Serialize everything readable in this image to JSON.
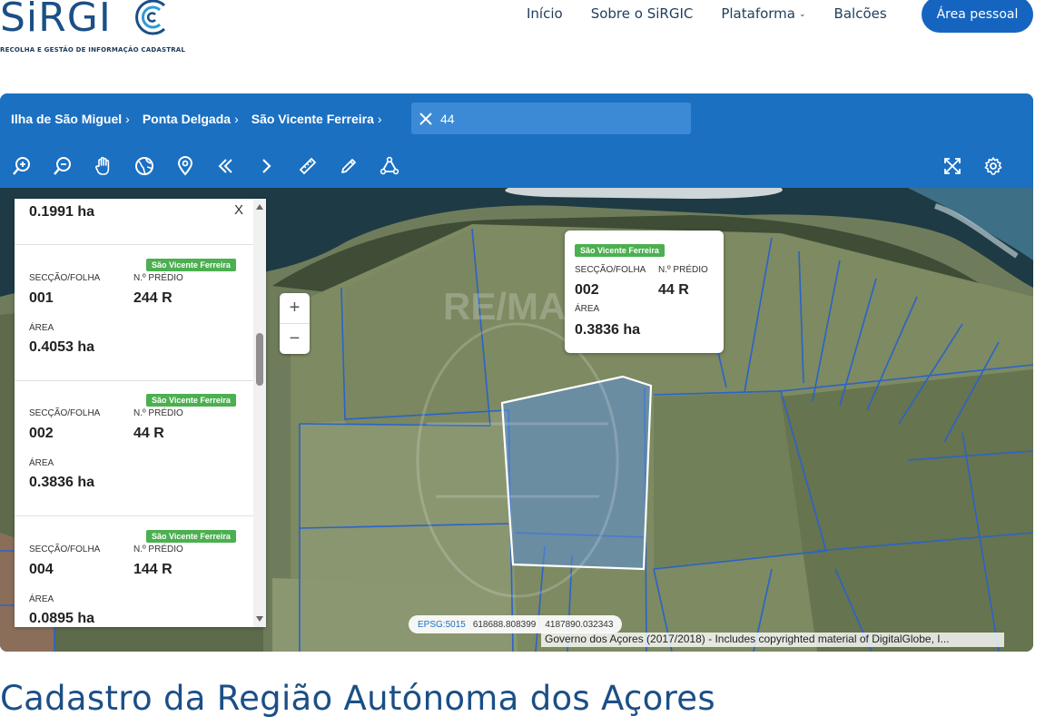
{
  "logo": {
    "wordmark": "SiRGI",
    "tagline": "RECOLHA E GESTÃO DE INFORMAÇÃO CADASTRAL"
  },
  "nav": {
    "items": [
      {
        "label": "Início"
      },
      {
        "label": "Sobre o SiRGIC"
      },
      {
        "label": "Plataforma"
      },
      {
        "label": "Balcões"
      }
    ],
    "cta_label": "Área pessoal"
  },
  "breadcrumb": [
    "Ilha de São Miguel",
    "Ponta Delgada",
    "São Vicente Ferreira"
  ],
  "search": {
    "value": "44"
  },
  "toolbar": {
    "tools": [
      "zoom-in-icon",
      "zoom-out-icon",
      "pan-hand-icon",
      "globe-icon",
      "location-pin-icon",
      "previous-extent-icon",
      "next-extent-icon",
      "measure-ruler-icon",
      "draw-pencil-icon",
      "polygon-select-icon"
    ],
    "right_tools": [
      "fullscreen-icon",
      "settings-gear-icon"
    ]
  },
  "map_zoom": {
    "plus": "+",
    "minus": "−"
  },
  "results": {
    "close_label": "X",
    "top_area": "0.1991 ha",
    "cards": [
      {
        "tag": "São Vicente Ferreira",
        "section_label": "SECÇÃO/FOLHA",
        "section": "001",
        "number_label": "N.º PRÉDIO",
        "number": "244 R",
        "area_label": "ÁREA",
        "area": "0.4053 ha"
      },
      {
        "tag": "São Vicente Ferreira",
        "section_label": "SECÇÃO/FOLHA",
        "section": "002",
        "number_label": "N.º PRÉDIO",
        "number": "44 R",
        "area_label": "ÁREA",
        "area": "0.3836 ha"
      },
      {
        "tag": "São Vicente Ferreira",
        "section_label": "SECÇÃO/FOLHA",
        "section": "004",
        "number_label": "N.º PRÉDIO",
        "number": "144 R",
        "area_label": "ÁREA",
        "area": "0.0895 ha"
      }
    ]
  },
  "popup": {
    "tag": "São Vicente Ferreira",
    "section_label": "SECÇÃO/FOLHA",
    "section": "002",
    "number_label": "N.º PRÉDIO",
    "number": "44 R",
    "area_label": "ÁREA",
    "area": "0.3836 ha"
  },
  "watermark": "RE/MAX",
  "coordinates": {
    "epsg": "EPSG:5015",
    "x": "618688.808399",
    "y": "4187890.032343"
  },
  "attribution": "Governo dos Açores (2017/2018) - Includes copyrighted material of DigitalGlobe, I...",
  "page_title": "Cadastro da Região Autónoma dos Açores",
  "colors": {
    "brand_blue": "#1b70c2",
    "tag_green": "#4caf50",
    "selected_parcel": "#5b8fd6",
    "parcel_line": "#2a63c9"
  }
}
